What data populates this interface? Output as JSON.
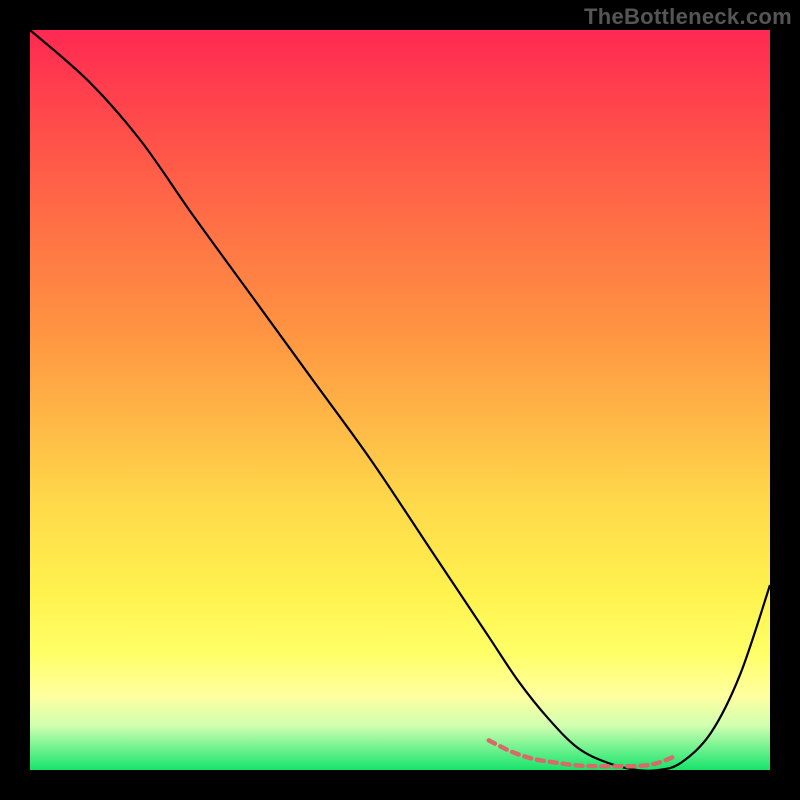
{
  "watermark": "TheBottleneck.com",
  "chart_data": {
    "type": "line",
    "title": "",
    "xlabel": "",
    "ylabel": "",
    "xlim": [
      0,
      100
    ],
    "ylim": [
      0,
      100
    ],
    "grid": false,
    "series": [
      {
        "name": "curve",
        "color": "#000000",
        "stroke_width": 2.2,
        "x": [
          0,
          8,
          15,
          22,
          30,
          38,
          46,
          54,
          58,
          62,
          66,
          70,
          74,
          78,
          82,
          85,
          88,
          92,
          96,
          100
        ],
        "values": [
          100,
          93,
          85,
          75,
          64,
          53,
          42,
          30,
          24,
          18,
          12,
          7,
          3,
          1,
          0,
          0,
          1,
          5,
          13,
          25
        ]
      },
      {
        "name": "flat-region-markers",
        "color": "#d86a6a",
        "stroke_width": 4.5,
        "x": [
          62,
          65,
          68,
          71,
          74,
          77,
          80,
          83,
          85,
          87
        ],
        "values": [
          4,
          2.5,
          1.5,
          1,
          0.6,
          0.5,
          0.5,
          0.6,
          1,
          1.8
        ]
      }
    ]
  }
}
